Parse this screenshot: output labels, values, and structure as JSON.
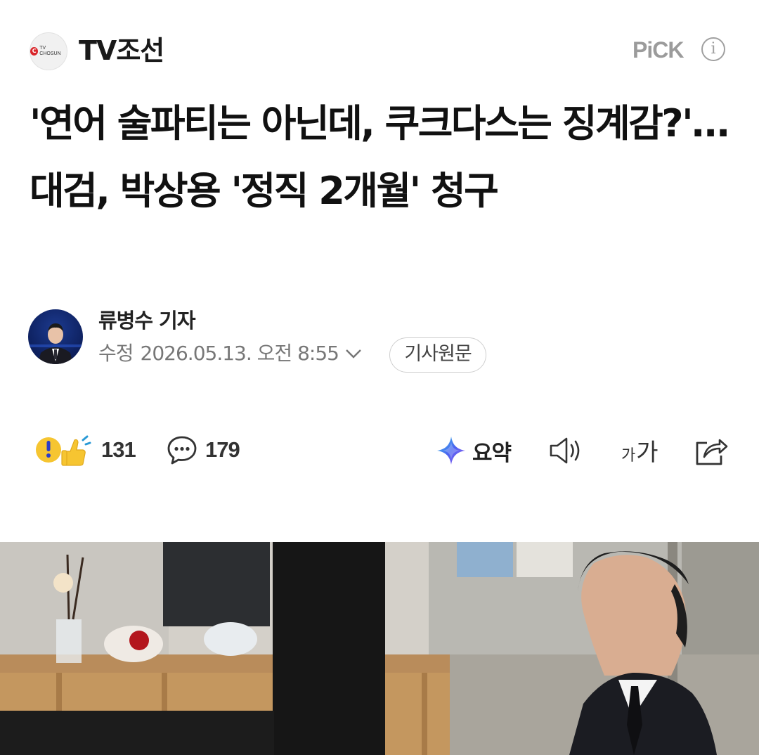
{
  "header": {
    "press_name": "TV조선",
    "press_logo_text": "TV CHOSUN",
    "pick_label": "PiCK",
    "info_glyph": "i"
  },
  "article": {
    "headline": "'연어 술파티는 아닌데, 쿠크다스는 징계감?'…대검, 박상용 '정직 2개월' 청구",
    "reporter_name": "류병수 기자",
    "modified_label": "수정",
    "modified_time": "2026.05.13. 오전 8:55",
    "original_button": "기사원문"
  },
  "actions": {
    "reaction_count": "131",
    "comment_count": "179",
    "summary_label": "요약",
    "font_small": "가",
    "font_large": "가"
  },
  "icons": {
    "press_logo": "tv-chosun-logo",
    "info": "info-circle-icon",
    "chevron": "chevron-down-icon",
    "reaction": "reaction-emoji-icon",
    "comment": "speech-bubble-icon",
    "summary": "ai-sparkle-icon",
    "tts": "speaker-icon",
    "share": "share-icon"
  },
  "colors": {
    "press_logo_red": "#d9262b",
    "muted_gray": "#9b9b9b",
    "headline": "#111111",
    "reaction_yellow": "#f6c531",
    "summary_blue": "#4a63f0"
  }
}
